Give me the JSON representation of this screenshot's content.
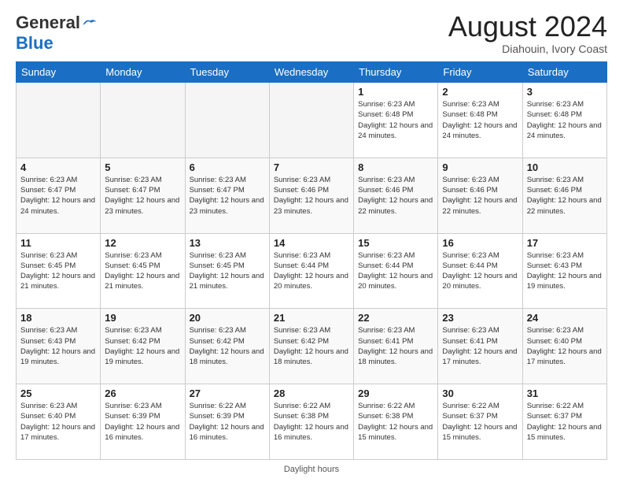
{
  "header": {
    "logo_line1": "General",
    "logo_line2": "Blue",
    "month_title": "August 2024",
    "location": "Diahouin, Ivory Coast"
  },
  "footer": {
    "label": "Daylight hours"
  },
  "days_of_week": [
    "Sunday",
    "Monday",
    "Tuesday",
    "Wednesday",
    "Thursday",
    "Friday",
    "Saturday"
  ],
  "weeks": [
    [
      {
        "day": "",
        "info": ""
      },
      {
        "day": "",
        "info": ""
      },
      {
        "day": "",
        "info": ""
      },
      {
        "day": "",
        "info": ""
      },
      {
        "day": "1",
        "info": "Sunrise: 6:23 AM\nSunset: 6:48 PM\nDaylight: 12 hours\nand 24 minutes."
      },
      {
        "day": "2",
        "info": "Sunrise: 6:23 AM\nSunset: 6:48 PM\nDaylight: 12 hours\nand 24 minutes."
      },
      {
        "day": "3",
        "info": "Sunrise: 6:23 AM\nSunset: 6:48 PM\nDaylight: 12 hours\nand 24 minutes."
      }
    ],
    [
      {
        "day": "4",
        "info": "Sunrise: 6:23 AM\nSunset: 6:47 PM\nDaylight: 12 hours\nand 24 minutes."
      },
      {
        "day": "5",
        "info": "Sunrise: 6:23 AM\nSunset: 6:47 PM\nDaylight: 12 hours\nand 23 minutes."
      },
      {
        "day": "6",
        "info": "Sunrise: 6:23 AM\nSunset: 6:47 PM\nDaylight: 12 hours\nand 23 minutes."
      },
      {
        "day": "7",
        "info": "Sunrise: 6:23 AM\nSunset: 6:46 PM\nDaylight: 12 hours\nand 23 minutes."
      },
      {
        "day": "8",
        "info": "Sunrise: 6:23 AM\nSunset: 6:46 PM\nDaylight: 12 hours\nand 22 minutes."
      },
      {
        "day": "9",
        "info": "Sunrise: 6:23 AM\nSunset: 6:46 PM\nDaylight: 12 hours\nand 22 minutes."
      },
      {
        "day": "10",
        "info": "Sunrise: 6:23 AM\nSunset: 6:46 PM\nDaylight: 12 hours\nand 22 minutes."
      }
    ],
    [
      {
        "day": "11",
        "info": "Sunrise: 6:23 AM\nSunset: 6:45 PM\nDaylight: 12 hours\nand 21 minutes."
      },
      {
        "day": "12",
        "info": "Sunrise: 6:23 AM\nSunset: 6:45 PM\nDaylight: 12 hours\nand 21 minutes."
      },
      {
        "day": "13",
        "info": "Sunrise: 6:23 AM\nSunset: 6:45 PM\nDaylight: 12 hours\nand 21 minutes."
      },
      {
        "day": "14",
        "info": "Sunrise: 6:23 AM\nSunset: 6:44 PM\nDaylight: 12 hours\nand 20 minutes."
      },
      {
        "day": "15",
        "info": "Sunrise: 6:23 AM\nSunset: 6:44 PM\nDaylight: 12 hours\nand 20 minutes."
      },
      {
        "day": "16",
        "info": "Sunrise: 6:23 AM\nSunset: 6:44 PM\nDaylight: 12 hours\nand 20 minutes."
      },
      {
        "day": "17",
        "info": "Sunrise: 6:23 AM\nSunset: 6:43 PM\nDaylight: 12 hours\nand 19 minutes."
      }
    ],
    [
      {
        "day": "18",
        "info": "Sunrise: 6:23 AM\nSunset: 6:43 PM\nDaylight: 12 hours\nand 19 minutes."
      },
      {
        "day": "19",
        "info": "Sunrise: 6:23 AM\nSunset: 6:42 PM\nDaylight: 12 hours\nand 19 minutes."
      },
      {
        "day": "20",
        "info": "Sunrise: 6:23 AM\nSunset: 6:42 PM\nDaylight: 12 hours\nand 18 minutes."
      },
      {
        "day": "21",
        "info": "Sunrise: 6:23 AM\nSunset: 6:42 PM\nDaylight: 12 hours\nand 18 minutes."
      },
      {
        "day": "22",
        "info": "Sunrise: 6:23 AM\nSunset: 6:41 PM\nDaylight: 12 hours\nand 18 minutes."
      },
      {
        "day": "23",
        "info": "Sunrise: 6:23 AM\nSunset: 6:41 PM\nDaylight: 12 hours\nand 17 minutes."
      },
      {
        "day": "24",
        "info": "Sunrise: 6:23 AM\nSunset: 6:40 PM\nDaylight: 12 hours\nand 17 minutes."
      }
    ],
    [
      {
        "day": "25",
        "info": "Sunrise: 6:23 AM\nSunset: 6:40 PM\nDaylight: 12 hours\nand 17 minutes."
      },
      {
        "day": "26",
        "info": "Sunrise: 6:23 AM\nSunset: 6:39 PM\nDaylight: 12 hours\nand 16 minutes."
      },
      {
        "day": "27",
        "info": "Sunrise: 6:22 AM\nSunset: 6:39 PM\nDaylight: 12 hours\nand 16 minutes."
      },
      {
        "day": "28",
        "info": "Sunrise: 6:22 AM\nSunset: 6:38 PM\nDaylight: 12 hours\nand 16 minutes."
      },
      {
        "day": "29",
        "info": "Sunrise: 6:22 AM\nSunset: 6:38 PM\nDaylight: 12 hours\nand 15 minutes."
      },
      {
        "day": "30",
        "info": "Sunrise: 6:22 AM\nSunset: 6:37 PM\nDaylight: 12 hours\nand 15 minutes."
      },
      {
        "day": "31",
        "info": "Sunrise: 6:22 AM\nSunset: 6:37 PM\nDaylight: 12 hours\nand 15 minutes."
      }
    ]
  ]
}
